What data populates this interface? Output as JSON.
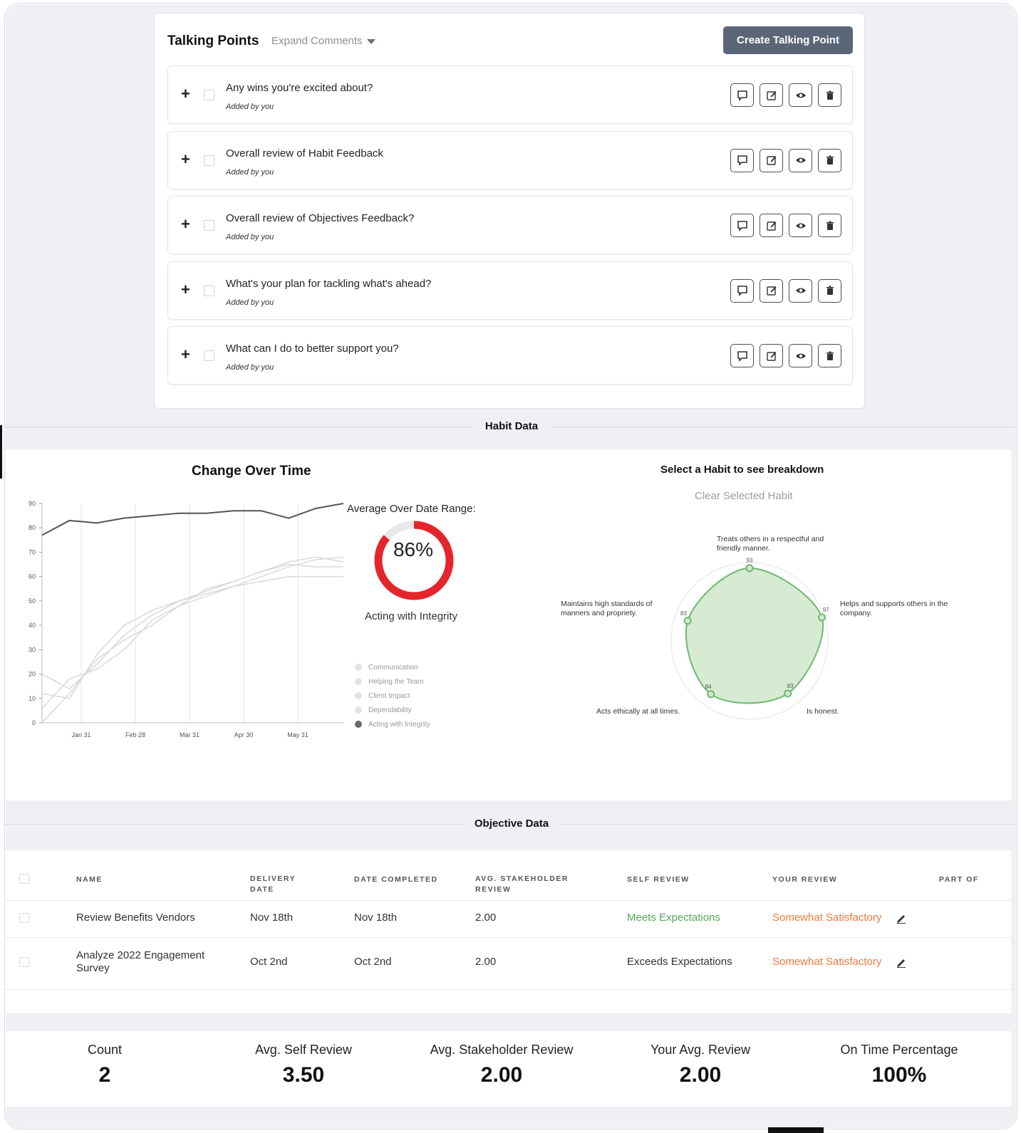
{
  "talking_points": {
    "title": "Talking Points",
    "expand_label": "Expand Comments",
    "create_label": "Create Talking Point",
    "items": [
      {
        "text": "Any wins you're excited about?",
        "added_by": "Added by you"
      },
      {
        "text": "Overall review of Habit Feedback",
        "added_by": "Added by you"
      },
      {
        "text": "Overall review of Objectives Feedback?",
        "added_by": "Added by you"
      },
      {
        "text": "What's your plan for tackling what's ahead?",
        "added_by": "Added by you"
      },
      {
        "text": "What can I do to better support you?",
        "added_by": "Added by you"
      }
    ],
    "actions": [
      "comment-icon",
      "edit-icon",
      "eye-icon",
      "trash-icon"
    ]
  },
  "habit_data": {
    "section_title": "Habit Data",
    "change_title": "Change Over Time",
    "average_label": "Average Over Date Range:",
    "average_value": "86%",
    "average_fraction": 0.86,
    "selected_habit": "Acting with Integrity",
    "legend": [
      "Communication",
      "Helping the Team",
      "Client Impact",
      "Dependability",
      "Acting with Integrity"
    ],
    "radar_title": "Select a Habit to see breakdown",
    "clear_label": "Clear Selected Habit"
  },
  "chart_data": [
    {
      "type": "line",
      "title": "",
      "xlabel": "",
      "ylabel": "",
      "x_ticks": [
        "Jan 31",
        "Feb 28",
        "Mar 31",
        "Apr 30",
        "May 31"
      ],
      "y_ticks": [
        0,
        10,
        20,
        30,
        40,
        50,
        60,
        70,
        80,
        90
      ],
      "ylim": [
        0,
        90
      ],
      "x": [
        "Jan 1",
        "Jan 15",
        "Jan 31",
        "Feb 14",
        "Feb 28",
        "Mar 15",
        "Mar 31",
        "Apr 15",
        "Apr 30",
        "May 15",
        "May 31",
        "Jun 15"
      ],
      "series": [
        {
          "name": "Acting with Integrity",
          "color": "#555555",
          "values": [
            77,
            83,
            82,
            84,
            85,
            86,
            86,
            87,
            87,
            84,
            88,
            90
          ]
        },
        {
          "name": "Communication",
          "color": "#d9d9d9",
          "values": [
            12,
            10,
            28,
            40,
            46,
            50,
            54,
            58,
            62,
            66,
            68,
            66
          ]
        },
        {
          "name": "Helping the Team",
          "color": "#d9d9d9",
          "values": [
            20,
            14,
            24,
            36,
            44,
            50,
            53,
            56,
            60,
            64,
            67,
            68
          ]
        },
        {
          "name": "Client Impact",
          "color": "#d9d9d9",
          "values": [
            6,
            18,
            22,
            30,
            42,
            48,
            55,
            58,
            62,
            65,
            64,
            64
          ]
        },
        {
          "name": "Dependability",
          "color": "#d9d9d9",
          "values": [
            0,
            12,
            26,
            34,
            40,
            48,
            52,
            56,
            58,
            60,
            60,
            60
          ]
        }
      ],
      "legend_position": "right",
      "grid": true
    },
    {
      "type": "radar",
      "title": "",
      "axes": [
        {
          "label": "Treats others in a respectful and friendly manner.",
          "value": 93
        },
        {
          "label": "Helps and supports others in the company.",
          "value": 97
        },
        {
          "label": "Is honest.",
          "value": 83
        },
        {
          "label": "Acts ethically at all times.",
          "value": 84
        },
        {
          "label": "Maintains high standards of manners and propriety.",
          "value": 83
        }
      ],
      "rmax": 100,
      "color": "#6fb86f"
    }
  ],
  "objective_data": {
    "section_title": "Objective Data",
    "columns": [
      "NAME",
      "DELIVERY DATE",
      "DATE COMPLETED",
      "AVG. STAKEHOLDER REVIEW",
      "SELF REVIEW",
      "YOUR REVIEW",
      "PART OF"
    ],
    "rows": [
      {
        "name": "Review Benefits Vendors",
        "delivery": "Nov 18th",
        "completed": "Nov 18th",
        "avg": "2.00",
        "self": "Meets Expectations",
        "yours": "Somewhat Satisfactory"
      },
      {
        "name": "Analyze 2022 Engagement Survey",
        "delivery": "Oct 2nd",
        "completed": "Oct 2nd",
        "avg": "2.00",
        "self": "Exceeds Expectations",
        "yours": "Somewhat Satisfactory"
      }
    ]
  },
  "summary": [
    {
      "label": "Count",
      "value": "2"
    },
    {
      "label": "Avg. Self Review",
      "value": "3.50"
    },
    {
      "label": "Avg. Stakeholder Review",
      "value": "2.00"
    },
    {
      "label": "Your Avg. Review",
      "value": "2.00"
    },
    {
      "label": "On Time Percentage",
      "value": "100%"
    }
  ],
  "colors": {
    "accent_button": "#5a6678",
    "gauge": "#e4262c",
    "radar_fill": "#d4ead0",
    "radar_stroke": "#6fb86f",
    "positive": "#5ca55c",
    "warning": "#f07a3a"
  }
}
